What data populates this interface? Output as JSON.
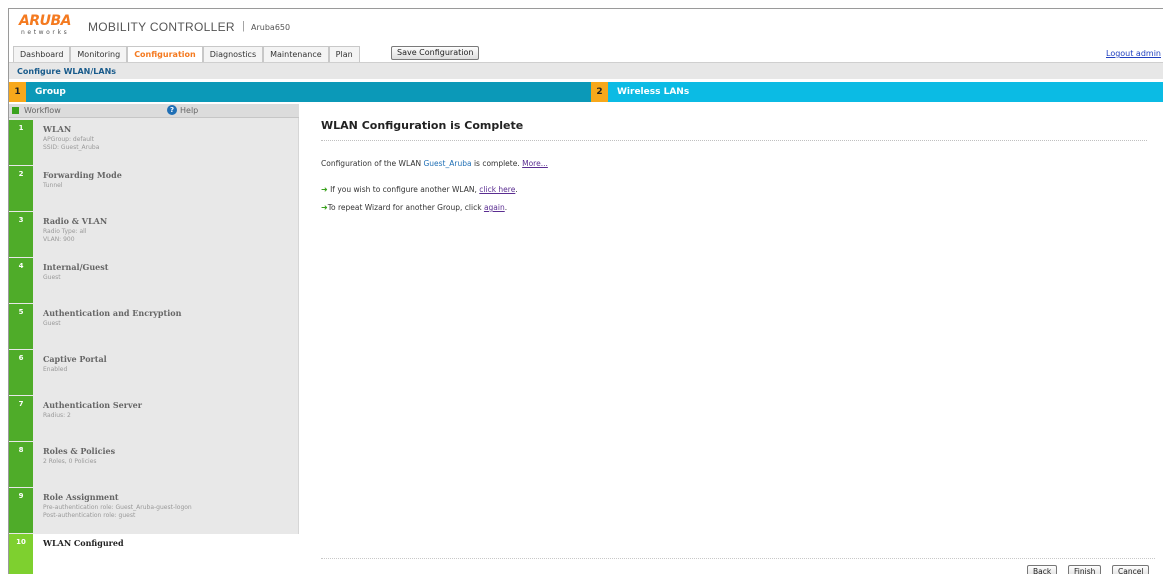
{
  "header": {
    "logo_word": "ARUBA",
    "logo_sub": "networks",
    "product": "MOBILITY CONTROLLER",
    "separator": "|",
    "hostname": "Aruba650",
    "tabs": [
      {
        "label": "Dashboard",
        "active": false
      },
      {
        "label": "Monitoring",
        "active": false
      },
      {
        "label": "Configuration",
        "active": true
      },
      {
        "label": "Diagnostics",
        "active": false
      },
      {
        "label": "Maintenance",
        "active": false
      },
      {
        "label": "Plan",
        "active": false
      }
    ],
    "save_label": "Save Configuration",
    "logout_label": "Logout admin"
  },
  "page_title": "Configure WLAN/LANs",
  "banner": {
    "step1_num": "1",
    "step1_label": "Group",
    "step2_num": "2",
    "step2_label": "Wireless LANs"
  },
  "sidebar": {
    "workflow_label": "Workflow",
    "help_label": "Help",
    "steps": [
      {
        "num": "1",
        "title": "WLAN",
        "detail": "APGroup: default\nSSID: Guest_Aruba"
      },
      {
        "num": "2",
        "title": "Forwarding Mode",
        "detail": "Tunnel"
      },
      {
        "num": "3",
        "title": "Radio & VLAN",
        "detail": "Radio Type: all\nVLAN: 900"
      },
      {
        "num": "4",
        "title": "Internal/Guest",
        "detail": "Guest"
      },
      {
        "num": "5",
        "title": "Authentication and Encryption",
        "detail": "Guest"
      },
      {
        "num": "6",
        "title": "Captive Portal",
        "detail": "Enabled"
      },
      {
        "num": "7",
        "title": "Authentication Server",
        "detail": "Radius: 2"
      },
      {
        "num": "8",
        "title": "Roles & Policies",
        "detail": "2 Roles, 0 Policies"
      },
      {
        "num": "9",
        "title": "Role Assignment",
        "detail": "Pre-authentication role: Guest_Aruba-guest-logon\nPost-authentication role: guest"
      },
      {
        "num": "10",
        "title": "WLAN Configured",
        "detail": ""
      }
    ]
  },
  "main": {
    "title": "WLAN Configuration is Complete",
    "line1_prefix": "Configuration of the WLAN ",
    "line1_ssid": "Guest_Aruba",
    "line1_suffix": " is complete. ",
    "line1_link": "More...",
    "line2_text": " If you wish to configure another WLAN, ",
    "line2_link": "click here",
    "line2_end": ".",
    "line3_text": "To repeat Wizard for another Group, click ",
    "line3_link": "again",
    "line3_end": "."
  },
  "buttons": {
    "back": "Back",
    "finish": "Finish",
    "cancel": "Cancel"
  },
  "colors": {
    "brand_orange": "#f47a20",
    "banner_dark": "#0b99b8",
    "banner_light": "#0bbbe4",
    "step_badge": "#f7a81b",
    "step_green": "#4fac29",
    "step_current": "#7ed02f"
  }
}
